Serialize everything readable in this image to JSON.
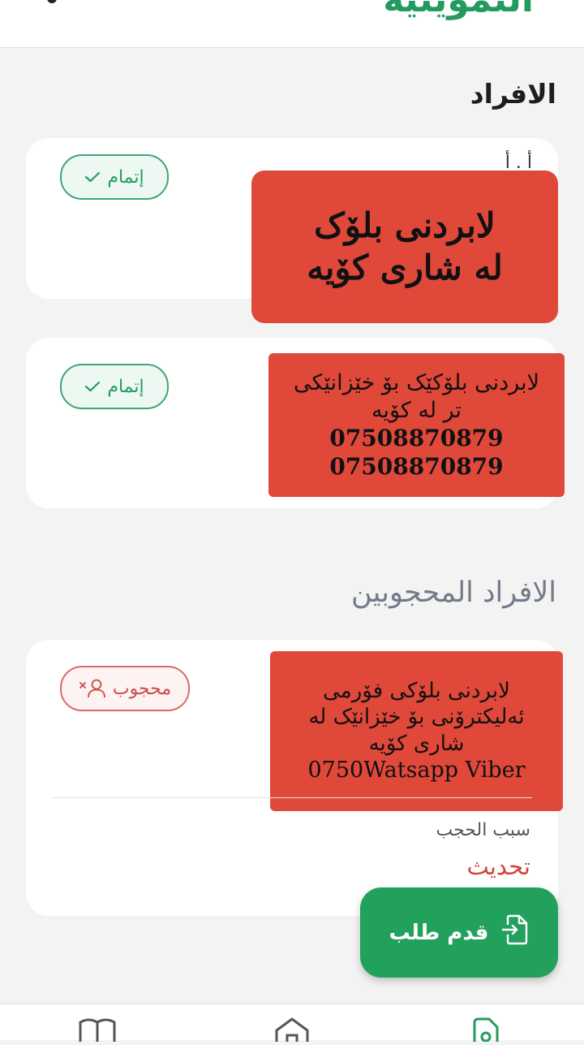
{
  "header": {
    "title": "التموينية"
  },
  "members_section": {
    "title": "الافراد",
    "cards": [
      {
        "partial_text": "أ . أ",
        "badge_label": "إتمام",
        "overlay_lines": [
          "لابردنی بلۆک",
          "له شاری کۆیه"
        ]
      },
      {
        "badge_label": "إتمام",
        "overlay_lines": [
          "لابردنی بلۆکێک بۆ خێزانێکی",
          "تر له کۆیه",
          "07508870879",
          "07508870879"
        ]
      }
    ]
  },
  "blocked_section": {
    "title": "الافراد المحجوبين",
    "card": {
      "badge_label": "محجوب",
      "overlay_lines": [
        "لابردنی بلۆکی فۆرمی",
        "ئەلیکترۆنی بۆ خێزانێک له",
        "شاری کۆیه",
        "0750Watsapp Viber"
      ],
      "reason_label": "سبب الحجب",
      "update_link": "تحديث"
    }
  },
  "fab": {
    "label": "قدم طلب"
  },
  "colors": {
    "primary_green": "#239b5e",
    "danger_red": "#d2443c",
    "overlay_red": "#e0483a"
  },
  "bottom_nav": {
    "icons": [
      "book-icon",
      "home-icon",
      "document-icon"
    ]
  }
}
